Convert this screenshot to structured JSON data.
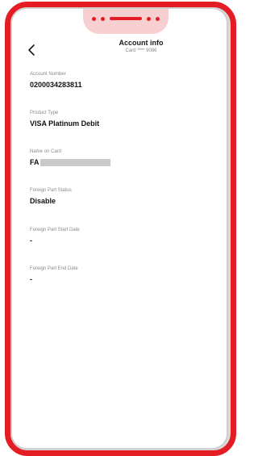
{
  "colors": {
    "frame": "#e31d23",
    "notch": "#f7cfd0",
    "label": "#8a8a8a",
    "value": "#111111"
  },
  "header": {
    "back_icon": "chevron-left-icon",
    "title": "Account info",
    "subtitle": "Card **** 9086"
  },
  "fields": [
    {
      "label": "Account Number",
      "value": "0200034283811"
    },
    {
      "label": "Product Type",
      "value": "VISA Platinum Debit"
    },
    {
      "label": "Name on Card",
      "value": "FA",
      "redacted": true
    },
    {
      "label": "Foreign Part Status",
      "value": "Disable"
    },
    {
      "label": "Foreign Part Start Date",
      "value": "-"
    },
    {
      "label": "Foreign Part End Date",
      "value": "-"
    }
  ]
}
